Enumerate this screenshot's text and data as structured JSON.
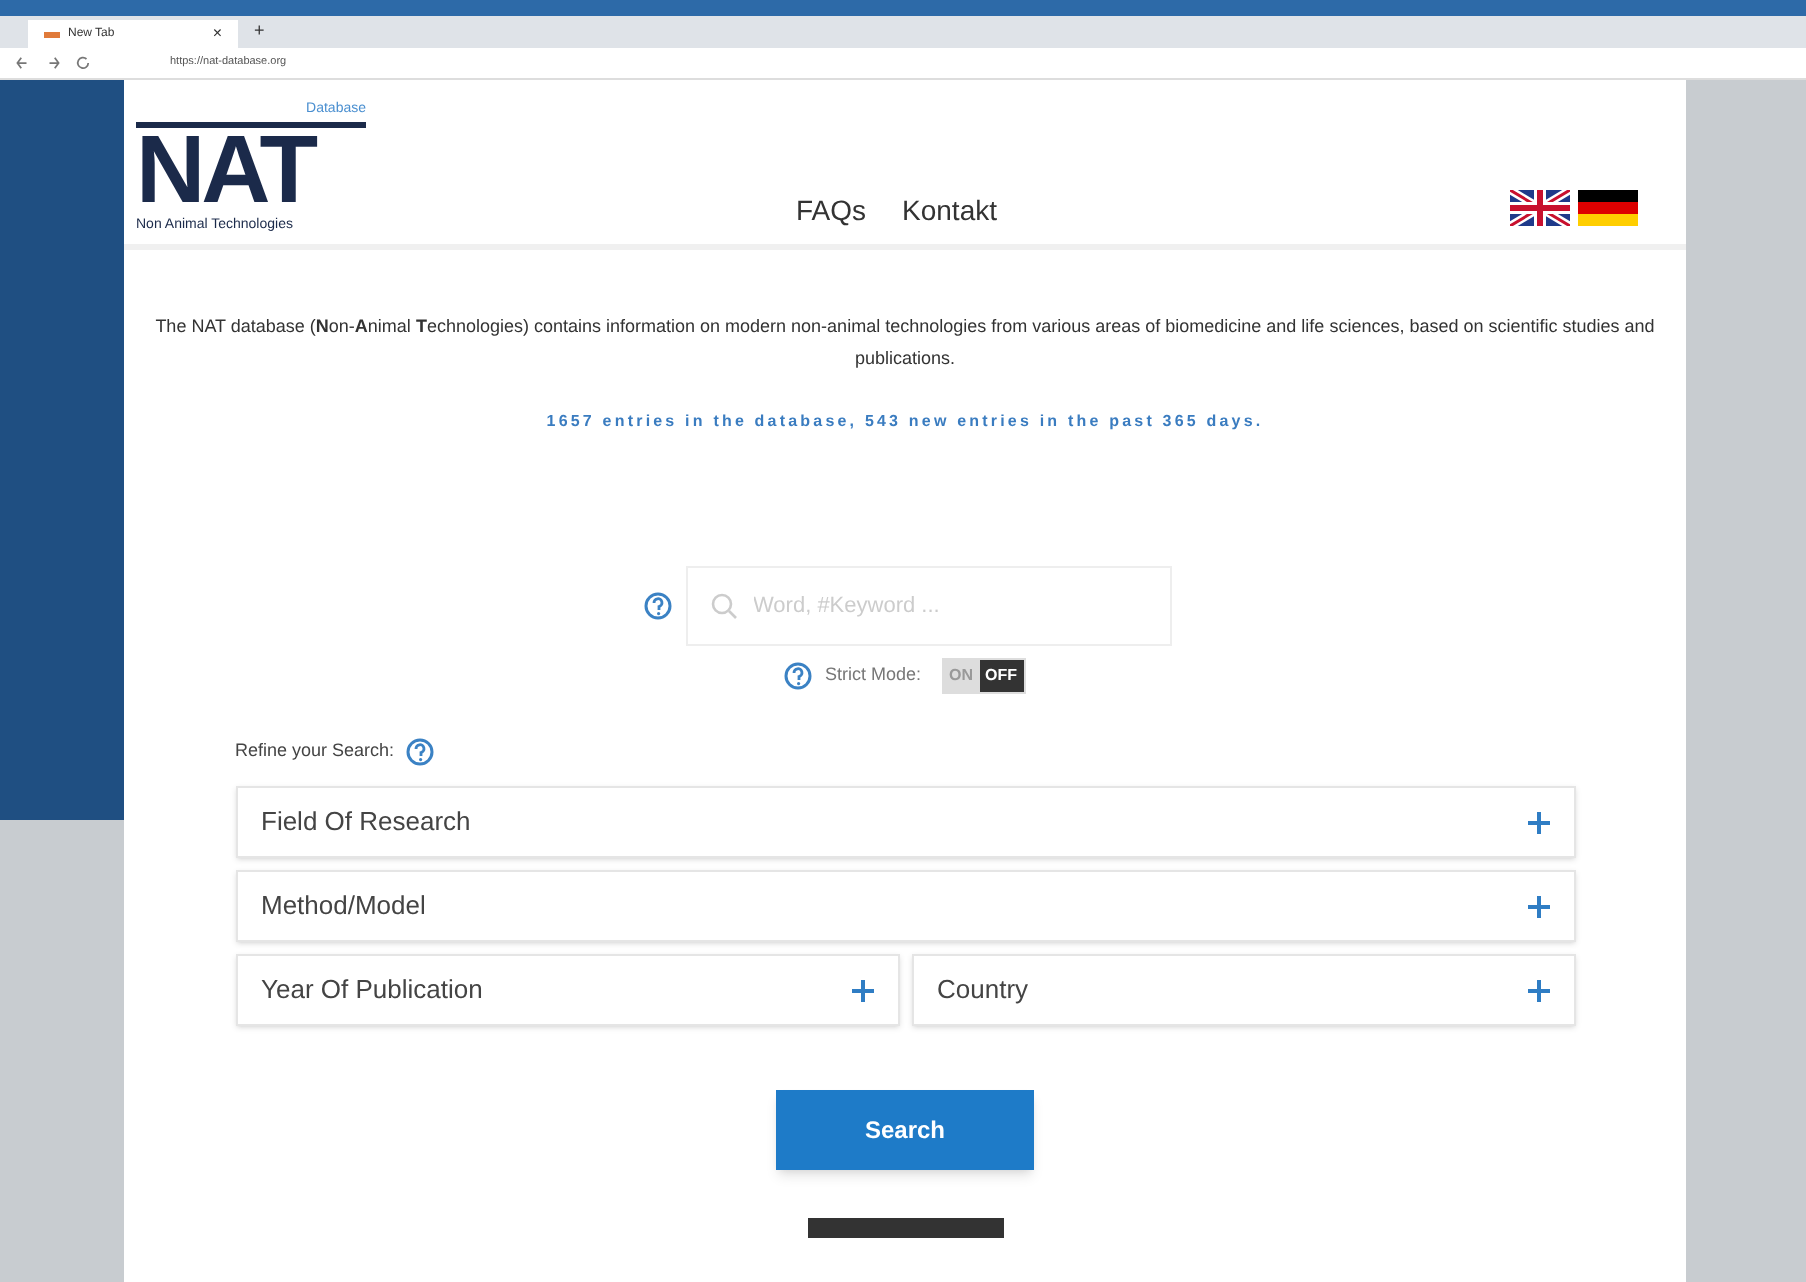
{
  "browser": {
    "tab_title": "New Tab",
    "tab_close": "×",
    "new_tab": "+",
    "url": "https://nat-database.org"
  },
  "logo": {
    "tag": "Database",
    "letters": "NAT",
    "subtitle": "Non Animal Technologies"
  },
  "nav": [
    "FAQs",
    "Kontakt"
  ],
  "intro": "The NAT database (**N**on-**A**nimal **T**echnologies) contains information on modern non-animal technologies from various areas of biomedicine and life sciences, based on scientific studies and publications.",
  "stats": "1657 entries in the database, 543 new entries in the past 365 days.",
  "search": {
    "placeholder": "Word, #Keyword ..."
  },
  "strict_mode": {
    "label": "Strict Mode:",
    "on_label": "ON",
    "off_label": "OFF",
    "on": false
  },
  "refine": {
    "label": "Refine your Search:"
  },
  "filters": [
    {
      "label": "Field Of Research",
      "expanded": false
    },
    {
      "label": "Method/Model",
      "expanded": false
    },
    {
      "label": "Year Of Publication",
      "expanded": false
    },
    {
      "label": "Country",
      "expanded": false
    }
  ],
  "search_button": "Search"
}
